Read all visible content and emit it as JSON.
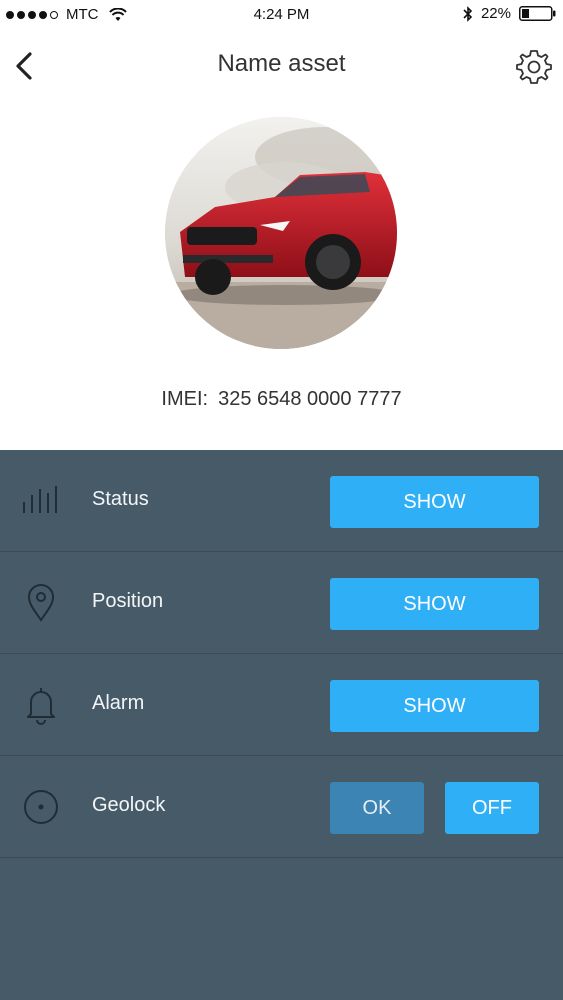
{
  "status_bar": {
    "carrier": "MTC",
    "time": "4:24 PM",
    "battery": "22%"
  },
  "header": {
    "title": "Name asset"
  },
  "asset": {
    "imei_label": "IMEI:",
    "imei_value": "325 6548 0000 7777"
  },
  "rows": [
    {
      "label": "Status",
      "icon": "signal-bars-icon",
      "button": "SHOW"
    },
    {
      "label": "Position",
      "icon": "location-pin-icon",
      "button": "SHOW"
    },
    {
      "label": "Alarm",
      "icon": "bell-icon",
      "button": "SHOW"
    },
    {
      "label": "Geolock",
      "icon": "target-icon",
      "buttons": [
        "OK",
        "OFF"
      ]
    }
  ],
  "colors": {
    "panel_bg": "#465a67",
    "accent": "#2fb0f6",
    "ok_button": "#3c84b4"
  }
}
